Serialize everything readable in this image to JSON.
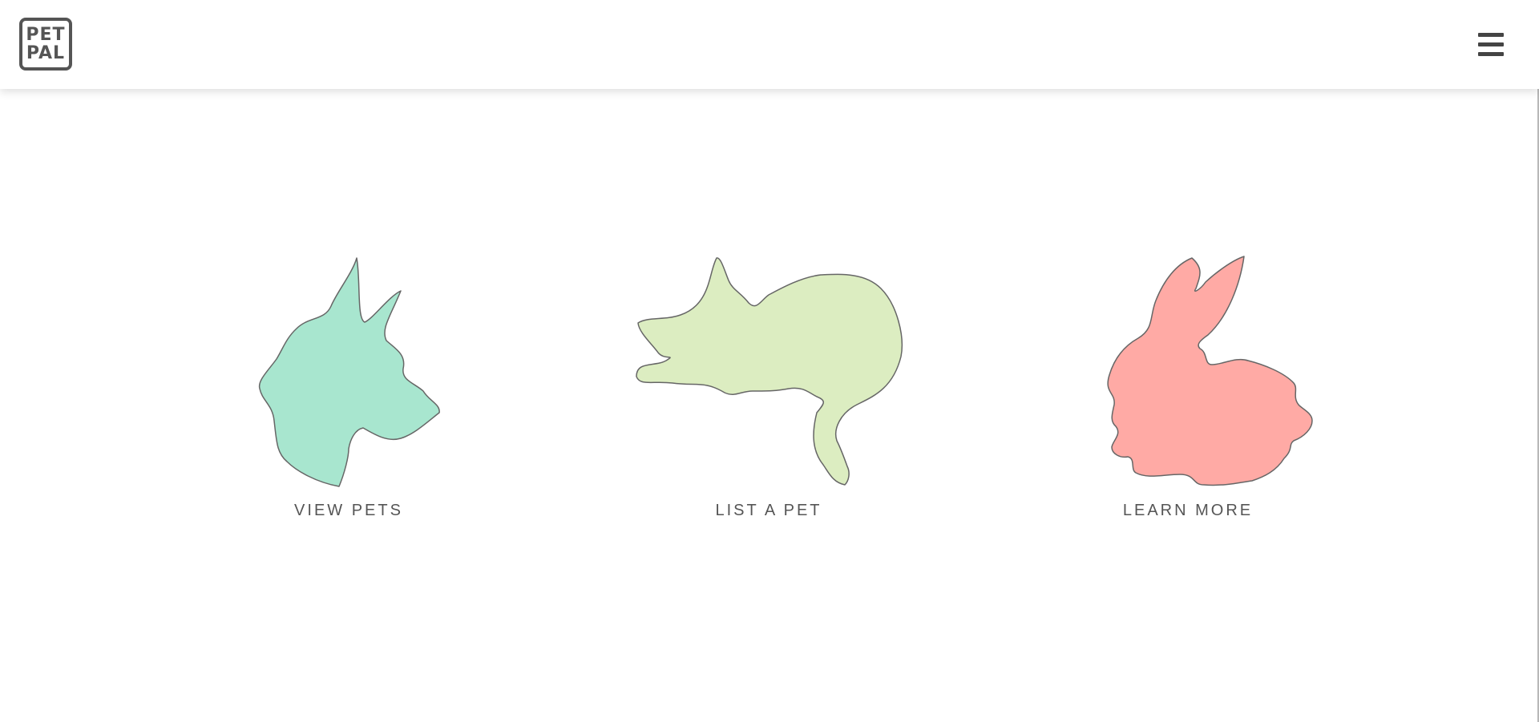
{
  "header": {
    "logo_line1": "PET",
    "logo_line2": "PAL",
    "menu_icon": "hamburger-menu-icon"
  },
  "options": [
    {
      "label": "VIEW PETS",
      "icon": "dog-silhouette-icon",
      "color": "#A8E6CF"
    },
    {
      "label": "LIST A PET",
      "icon": "cat-silhouette-icon",
      "color": "#DCEDC1"
    },
    {
      "label": "LEARN MORE",
      "icon": "bunny-silhouette-icon",
      "color": "#FFAAA5"
    }
  ],
  "colors": {
    "outline": "#666666",
    "text": "#555555"
  }
}
